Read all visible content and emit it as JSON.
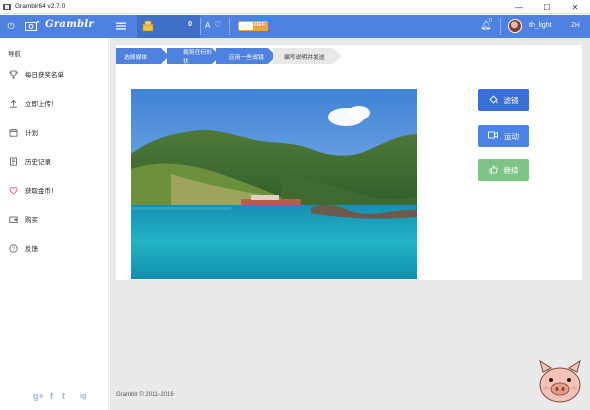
{
  "window": {
    "title": "Gramblr64 v2.7.0",
    "min_glyph": "—",
    "max_glyph": "☐",
    "close_glyph": "✕"
  },
  "header": {
    "brand": "Gramblr",
    "coin_count": "0",
    "toggle_label": "OFF",
    "notification_count": "0",
    "username": "th_light",
    "language": "ZH"
  },
  "sidebar": {
    "heading": "导航",
    "items": [
      {
        "label": "每日获奖名单",
        "icon": "trophy-icon",
        "glyph": "🏆"
      },
      {
        "label": "立即上传！",
        "icon": "upload-icon",
        "glyph": "⤒"
      },
      {
        "label": "计划",
        "icon": "calendar-icon",
        "glyph": "▦"
      },
      {
        "label": "历史记录",
        "icon": "history-icon",
        "glyph": "▤"
      },
      {
        "label": "获取金币！",
        "icon": "heart-icon",
        "glyph": "♡"
      },
      {
        "label": "购买",
        "icon": "wallet-icon",
        "glyph": "▭"
      },
      {
        "label": "反馈",
        "icon": "help-icon",
        "glyph": "?"
      }
    ],
    "social": [
      "g+",
      "f",
      "t",
      "ig"
    ]
  },
  "breadcrumbs": [
    "选择媒体",
    "裁剪任何形状",
    "应用一些滤镜",
    "编写说明并发送"
  ],
  "actions": {
    "filter_label": "滤镜",
    "motion_label": "运动",
    "continue_label": "继续"
  },
  "colors": {
    "header_blue": "#4f82e0",
    "coin_box": "#3f6fc7",
    "toggle_orange": "#f2a341",
    "filter_btn": "#3a6fd8",
    "motion_btn": "#4a82e6",
    "continue_btn": "#7cc586",
    "crumb_active": "#e8e8e8"
  },
  "footer": {
    "copyright": "Gramblr © 2011-2016"
  }
}
